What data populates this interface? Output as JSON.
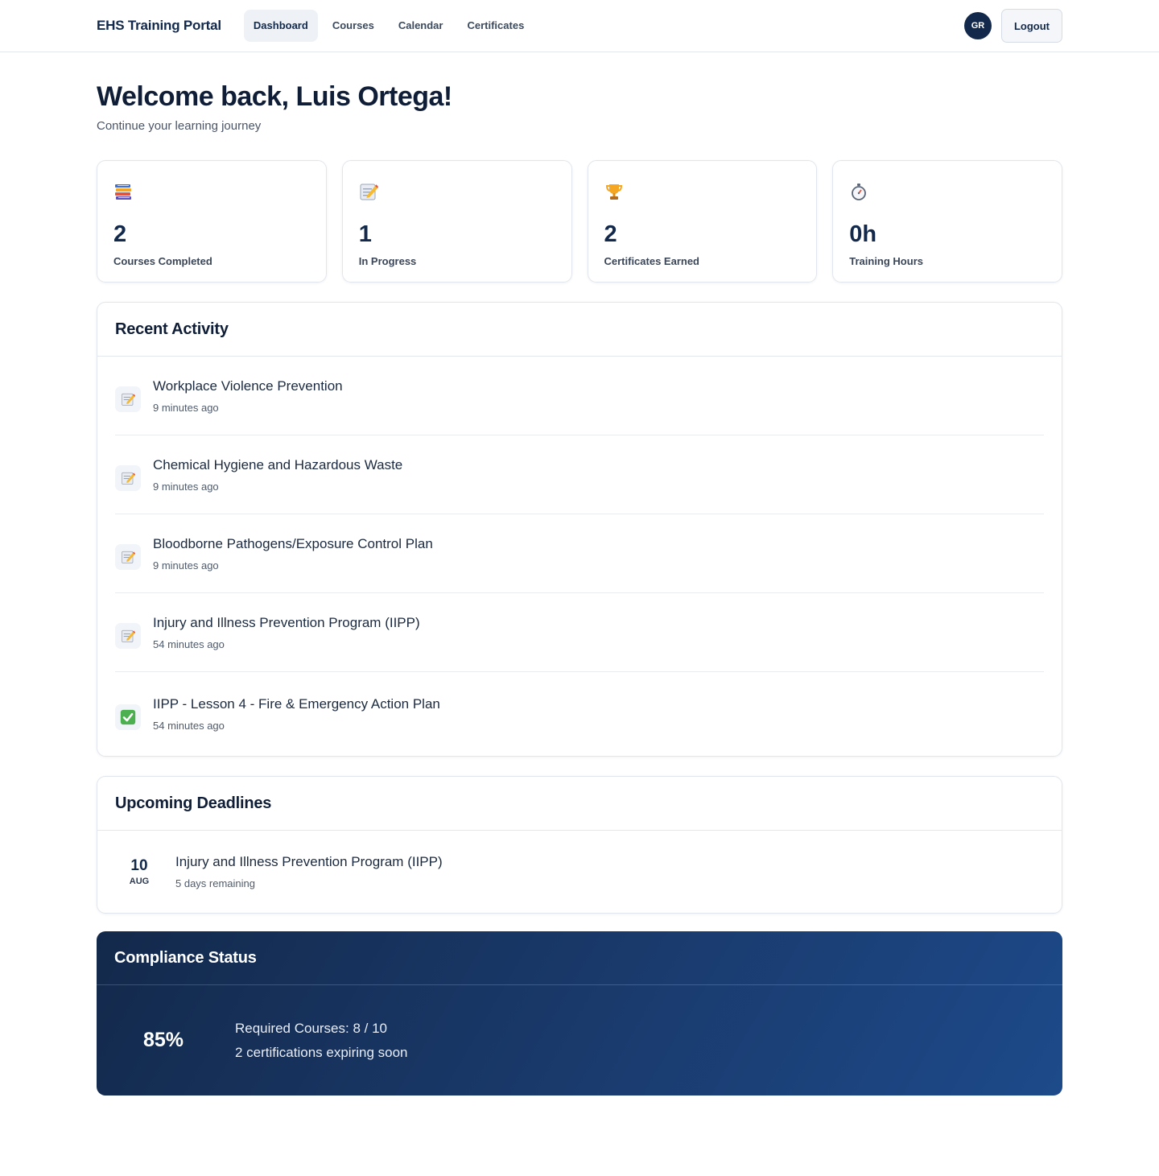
{
  "header": {
    "brand": "EHS Training Portal",
    "nav": [
      {
        "label": "Dashboard",
        "active": true
      },
      {
        "label": "Courses",
        "active": false
      },
      {
        "label": "Calendar",
        "active": false
      },
      {
        "label": "Certificates",
        "active": false
      }
    ],
    "avatar_initials": "GR",
    "logout_label": "Logout"
  },
  "welcome": {
    "title": "Welcome back, Luis Ortega!",
    "subtitle": "Continue your learning journey"
  },
  "stats": [
    {
      "icon": "books-icon",
      "value": "2",
      "label": "Courses Completed"
    },
    {
      "icon": "memo-icon",
      "value": "1",
      "label": "In Progress"
    },
    {
      "icon": "trophy-icon",
      "value": "2",
      "label": "Certificates Earned"
    },
    {
      "icon": "stopwatch-icon",
      "value": "0h",
      "label": "Training Hours"
    }
  ],
  "recent_activity": {
    "title": "Recent Activity",
    "items": [
      {
        "icon": "memo-icon",
        "title": "Workplace Violence Prevention",
        "time": "9 minutes ago"
      },
      {
        "icon": "memo-icon",
        "title": "Chemical Hygiene and Hazardous Waste",
        "time": "9 minutes ago"
      },
      {
        "icon": "memo-icon",
        "title": "Bloodborne Pathogens/Exposure Control Plan",
        "time": "9 minutes ago"
      },
      {
        "icon": "memo-icon",
        "title": "Injury and Illness Prevention Program (IIPP)",
        "time": "54 minutes ago"
      },
      {
        "icon": "check-icon",
        "title": "IIPP - Lesson 4 - Fire & Emergency Action Plan",
        "time": "54 minutes ago"
      }
    ]
  },
  "deadlines": {
    "title": "Upcoming Deadlines",
    "items": [
      {
        "day": "10",
        "month": "AUG",
        "title": "Injury and Illness Prevention Program (IIPP)",
        "remaining": "5 days remaining"
      }
    ]
  },
  "compliance": {
    "title": "Compliance Status",
    "percent": "85%",
    "required": "Required Courses: 8 / 10",
    "expiring": "2 certifications expiring soon"
  },
  "colors": {
    "brand_navy": "#13294b",
    "compliance_gradient_start": "#13294b",
    "compliance_gradient_end": "#1d4a8a",
    "check_green": "#4caf50"
  }
}
